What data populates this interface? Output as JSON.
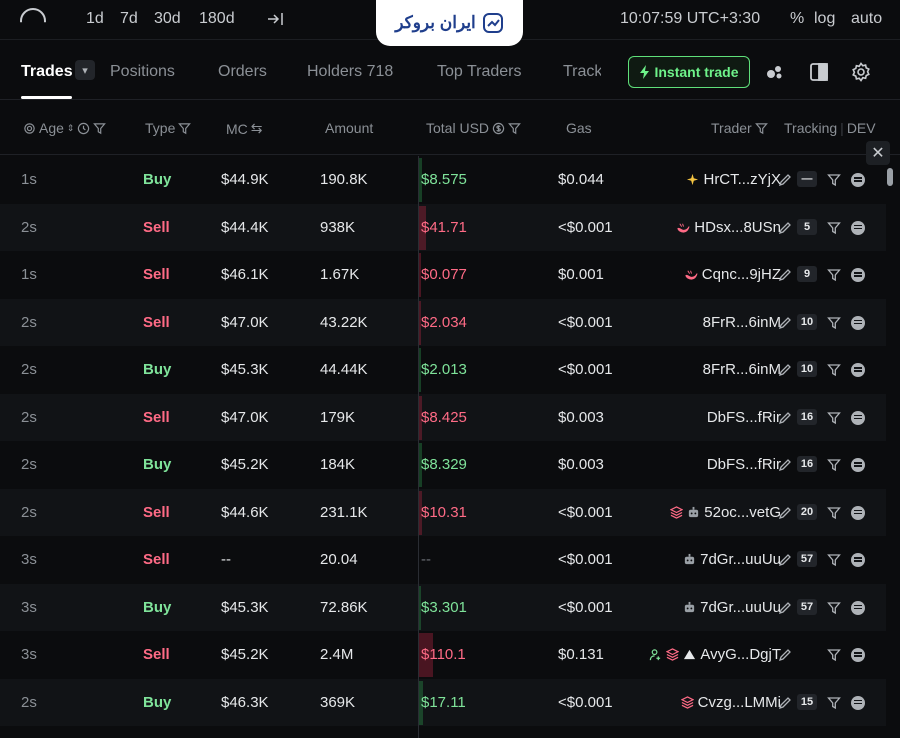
{
  "topbar": {
    "timeframes": [
      "1d",
      "7d",
      "30d",
      "180d"
    ],
    "clock": "10:07:59 UTC+3:30",
    "percent": "%",
    "log": "log",
    "auto": "auto"
  },
  "brand": {
    "name": "ایران بروکر"
  },
  "tabs": {
    "items": [
      "Trades",
      "Positions",
      "Orders",
      "Holders 718",
      "Top Traders",
      "Track"
    ],
    "instant_trade": "Instant trade"
  },
  "columns": {
    "age": "Age",
    "type": "Type",
    "mc": "MC",
    "amount": "Amount",
    "total_usd": "Total USD",
    "gas": "Gas",
    "trader": "Trader",
    "tracking": "Tracking",
    "dev": "DEV"
  },
  "trades": [
    {
      "age": "1s",
      "type": "Buy",
      "mc": "$44.9K",
      "amount": "190.8K",
      "usd": "$8.575",
      "gas": "$0.044",
      "trader": "HrCT...zYjX",
      "count": "—",
      "icon": "sparkle-icon"
    },
    {
      "age": "2s",
      "type": "Sell",
      "mc": "$44.4K",
      "amount": "938K",
      "usd": "$41.71",
      "gas": "<$0.001",
      "trader": "HDsx...8USn",
      "count": "5",
      "icon": "whale-icon"
    },
    {
      "age": "1s",
      "type": "Sell",
      "mc": "$46.1K",
      "amount": "1.67K",
      "usd": "$0.077",
      "gas": "$0.001",
      "trader": "Cqnc...9jHZ",
      "count": "9",
      "icon": "whale-icon"
    },
    {
      "age": "2s",
      "type": "Sell",
      "mc": "$47.0K",
      "amount": "43.22K",
      "usd": "$2.034",
      "gas": "<$0.001",
      "trader": "8FrR...6inM",
      "count": "10",
      "icon": ""
    },
    {
      "age": "2s",
      "type": "Buy",
      "mc": "$45.3K",
      "amount": "44.44K",
      "usd": "$2.013",
      "gas": "<$0.001",
      "trader": "8FrR...6inM",
      "count": "10",
      "icon": ""
    },
    {
      "age": "2s",
      "type": "Sell",
      "mc": "$47.0K",
      "amount": "179K",
      "usd": "$8.425",
      "gas": "$0.003",
      "trader": "DbFS...fRir",
      "count": "16",
      "icon": ""
    },
    {
      "age": "2s",
      "type": "Buy",
      "mc": "$45.2K",
      "amount": "184K",
      "usd": "$8.329",
      "gas": "$0.003",
      "trader": "DbFS...fRir",
      "count": "16",
      "icon": ""
    },
    {
      "age": "2s",
      "type": "Sell",
      "mc": "$44.6K",
      "amount": "231.1K",
      "usd": "$10.31",
      "gas": "<$0.001",
      "trader": "52oc...vetG",
      "count": "20",
      "icon": "layers-bot-icon"
    },
    {
      "age": "3s",
      "type": "Sell",
      "mc": "--",
      "amount": "20.04",
      "usd": "--",
      "gas": "<$0.001",
      "trader": "7dGr...uuUu",
      "count": "57",
      "icon": "bot-icon"
    },
    {
      "age": "3s",
      "type": "Buy",
      "mc": "$45.3K",
      "amount": "72.86K",
      "usd": "$3.301",
      "gas": "<$0.001",
      "trader": "7dGr...uuUu",
      "count": "57",
      "icon": "bot-icon"
    },
    {
      "age": "3s",
      "type": "Sell",
      "mc": "$45.2K",
      "amount": "2.4M",
      "usd": "$110.1",
      "gas": "$0.131",
      "trader": "AvyG...DgjT",
      "count": "",
      "icon": "user-layers-triangle-icon"
    },
    {
      "age": "2s",
      "type": "Buy",
      "mc": "$46.3K",
      "amount": "369K",
      "usd": "$17.11",
      "gas": "<$0.001",
      "trader": "Cvzg...LMMi",
      "count": "15",
      "icon": "layers-icon"
    }
  ],
  "colors": {
    "buy": "#7fe39a",
    "sell": "#ff6b86",
    "accent": "#5fe07a"
  }
}
